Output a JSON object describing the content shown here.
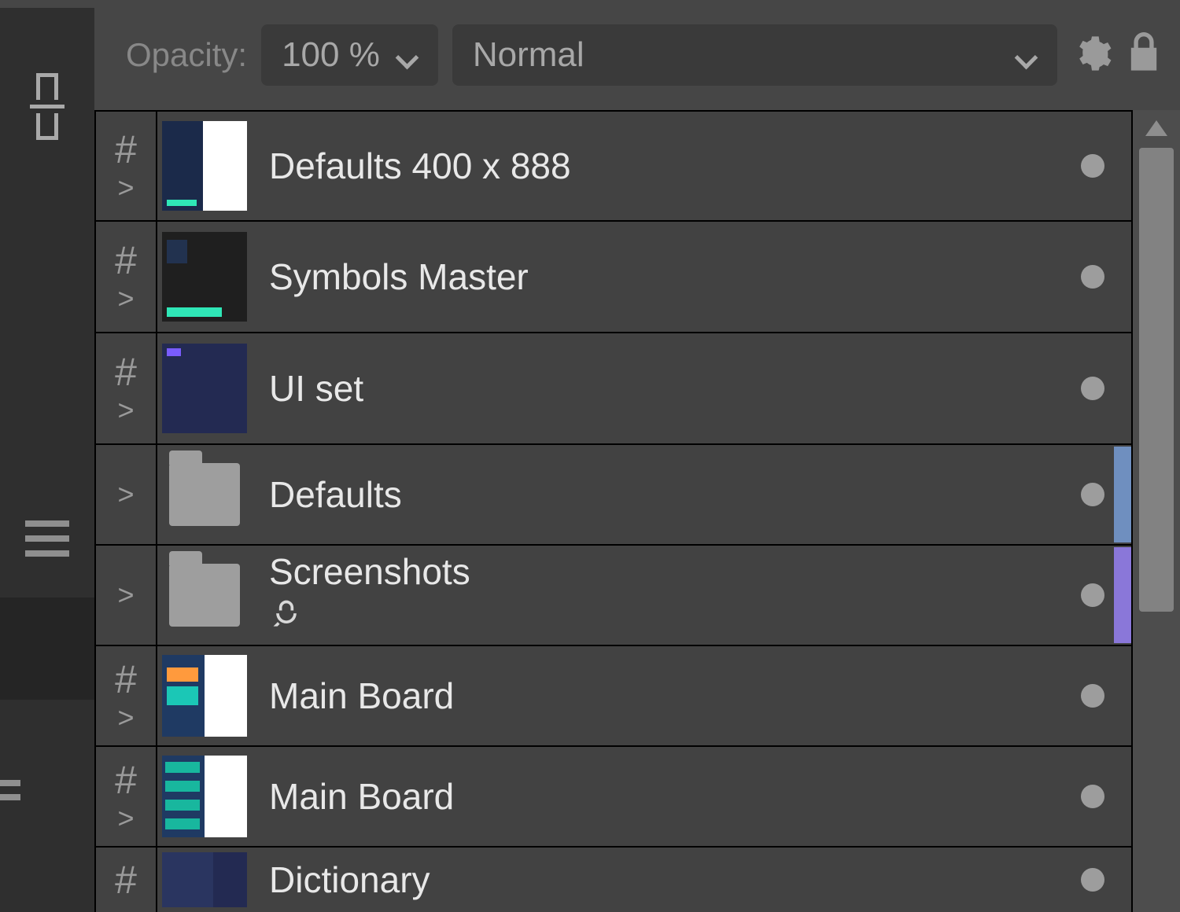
{
  "toolbar": {
    "opacity_label": "Opacity:",
    "opacity_value": "100 %",
    "blend_mode": "Normal"
  },
  "layers": [
    {
      "type": "artboard",
      "name": "Defaults 400 x 888",
      "thumb": "th-defaults"
    },
    {
      "type": "artboard",
      "name": "Symbols Master",
      "thumb": "th-symbols"
    },
    {
      "type": "artboard",
      "name": "UI set",
      "thumb": "th-uiset"
    },
    {
      "type": "folder",
      "name": "Defaults",
      "tag": "#6f8fbf"
    },
    {
      "type": "folder",
      "name": "Screenshots",
      "tag": "#8a77d9",
      "has_symbol": true
    },
    {
      "type": "artboard",
      "name": "Main Board",
      "thumb": "th-main1"
    },
    {
      "type": "artboard",
      "name": "Main Board",
      "thumb": "th-main2"
    },
    {
      "type": "artboard",
      "name": "Dictionary",
      "thumb": "th-dict",
      "partial": true
    }
  ]
}
